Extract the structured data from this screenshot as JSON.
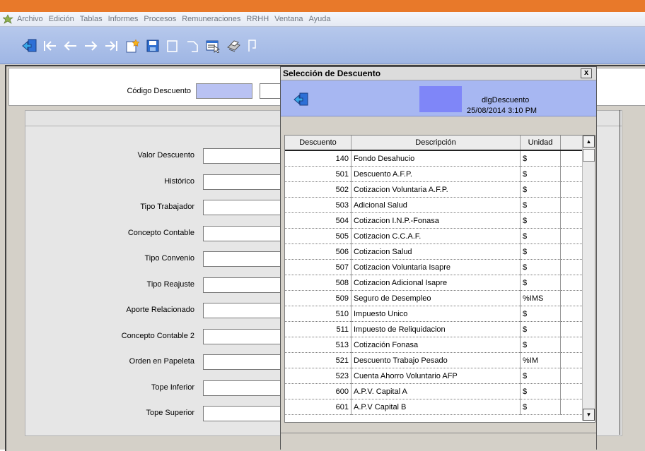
{
  "menu": [
    "Archivo",
    "Edición",
    "Tablas",
    "Informes",
    "Procesos",
    "Remuneraciones",
    "RRHH",
    "Ventana",
    "Ayuda"
  ],
  "toolbar_icons": [
    "exit-icon",
    "first-record-icon",
    "previous-record-icon",
    "next-record-icon",
    "last-record-icon",
    "new-record-icon",
    "save-icon",
    "blank-page-icon",
    "undo-icon",
    "select-list-icon",
    "print-icon",
    "copy-icon"
  ],
  "form": {
    "codigo_label": "Código Descuento",
    "fields": [
      "Valor Descuento",
      "Histórico",
      "Tipo Trabajador",
      "Concepto Contable",
      "Tipo Convenio",
      "Tipo Reajuste",
      "Aporte Relacionado",
      "Concepto Contable 2",
      "Orden en Papeleta",
      "Tope Inferior",
      "Tope Superior"
    ]
  },
  "dialog": {
    "title": "Selección de Descuento",
    "close_label": "x",
    "name": "dlgDescuento",
    "datetime": "25/08/2014 3:10 PM",
    "columns": [
      "Descuento",
      "Descripción",
      "Unidad"
    ],
    "rows": [
      {
        "code": "140",
        "desc": "Fondo Desahucio",
        "unit": "$"
      },
      {
        "code": "501",
        "desc": "Descuento A.F.P.",
        "unit": "$"
      },
      {
        "code": "502",
        "desc": "Cotizacion Voluntaria A.F.P.",
        "unit": "$"
      },
      {
        "code": "503",
        "desc": "Adicional Salud",
        "unit": "$"
      },
      {
        "code": "504",
        "desc": "Cotizacion I.N.P.-Fonasa",
        "unit": "$"
      },
      {
        "code": "505",
        "desc": "Cotizacion C.C.A.F.",
        "unit": "$"
      },
      {
        "code": "506",
        "desc": "Cotizacion Salud",
        "unit": "$"
      },
      {
        "code": "507",
        "desc": "Cotizacion Voluntaria Isapre",
        "unit": "$"
      },
      {
        "code": "508",
        "desc": "Cotizacion Adicional Isapre",
        "unit": "$"
      },
      {
        "code": "509",
        "desc": "Seguro de Desempleo",
        "unit": "%IMS"
      },
      {
        "code": "510",
        "desc": "Impuesto Unico",
        "unit": "$"
      },
      {
        "code": "511",
        "desc": "Impuesto de Reliquidacion",
        "unit": "$"
      },
      {
        "code": "513",
        "desc": "Cotización Fonasa",
        "unit": "$"
      },
      {
        "code": "521",
        "desc": "Descuento Trabajo Pesado",
        "unit": "%IM"
      },
      {
        "code": "523",
        "desc": "Cuenta Ahorro Voluntario AFP",
        "unit": "$"
      },
      {
        "code": "600",
        "desc": "A.P.V.  Capital  A",
        "unit": "$"
      },
      {
        "code": "601",
        "desc": "A.P.V Capital  B",
        "unit": "$"
      }
    ]
  },
  "colors": {
    "accent_orange": "#e8792a",
    "toolbar_blue": "#a9bde8",
    "field_lavender": "#b9c2f3",
    "dialog_header": "#a7b7f2",
    "swatch": "#7f86f8"
  }
}
